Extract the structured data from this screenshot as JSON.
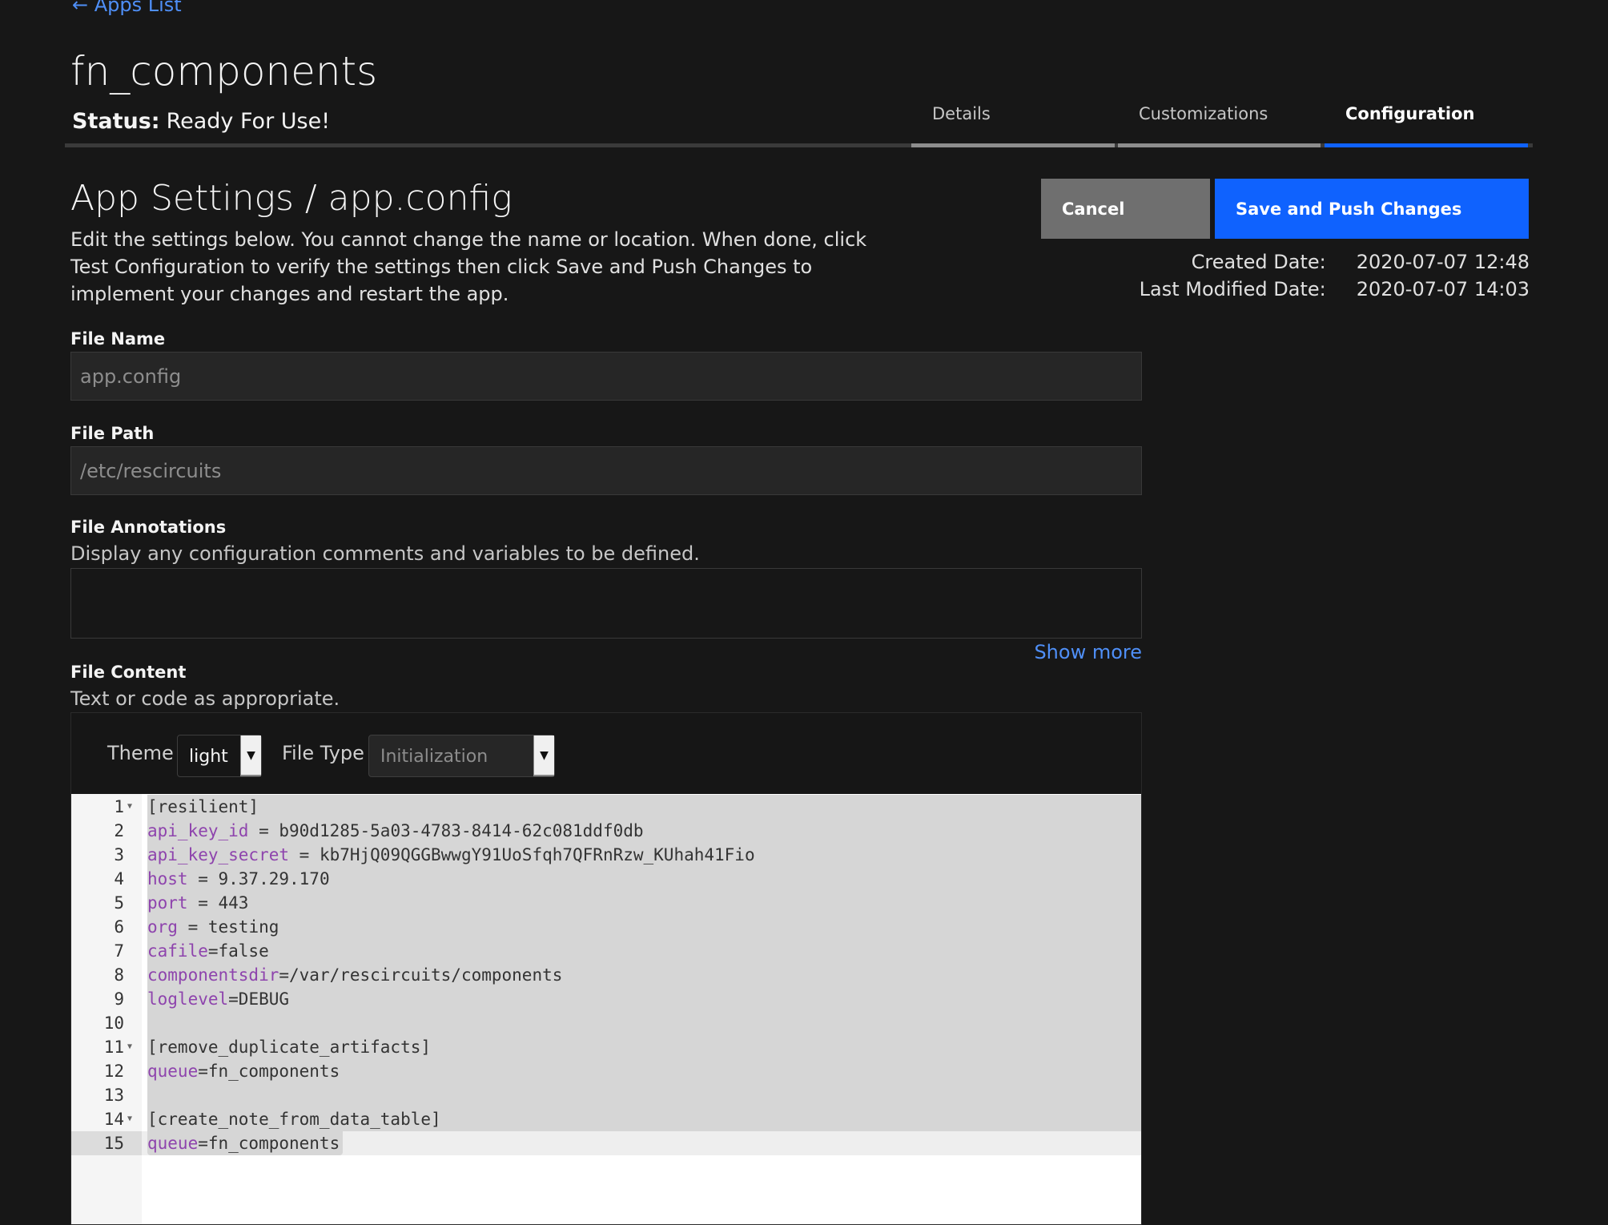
{
  "nav": {
    "back_label": "← Apps List"
  },
  "app": {
    "title": "fn_components",
    "status_label": "Status:",
    "status_value": "Ready For Use!"
  },
  "tabs": [
    {
      "label": "Details"
    },
    {
      "label": "Customizations"
    },
    {
      "label": "Configuration",
      "active": true
    }
  ],
  "settings": {
    "heading": "App Settings / app.config",
    "description": "Edit the settings below. You cannot change the name or location. When done, click Test Configuration to verify the settings then click Save and Push Changes to implement your changes and restart the app.",
    "cancel_label": "Cancel",
    "save_label": "Save and Push Changes",
    "created_label": "Created Date:",
    "created_value": "2020-07-07 12:48",
    "modified_label": "Last Modified Date:",
    "modified_value": "2020-07-07 14:03"
  },
  "form": {
    "file_name_label": "File Name",
    "file_name_value": "app.config",
    "file_path_label": "File Path",
    "file_path_value": "/etc/rescircuits",
    "annotations_label": "File Annotations",
    "annotations_desc": "Display any configuration comments and variables to be defined.",
    "show_more": "Show more",
    "content_label": "File Content",
    "content_desc": "Text or code as appropriate."
  },
  "editor": {
    "theme_label": "Theme",
    "theme_value": "light",
    "filetype_label": "File Type",
    "filetype_value": "Initialization",
    "lines": [
      {
        "n": "1",
        "fold": true,
        "key": "",
        "rest": "[resilient]"
      },
      {
        "n": "2",
        "key": "api_key_id",
        "rest": " = b90d1285-5a03-4783-8414-62c081ddf0db"
      },
      {
        "n": "3",
        "key": "api_key_secret",
        "rest": " = kb7HjQ09QGGBwwgY91UoSfqh7QFRnRzw_KUhah41Fio"
      },
      {
        "n": "4",
        "key": "host",
        "rest": " = 9.37.29.170"
      },
      {
        "n": "5",
        "key": "port",
        "rest": " = 443"
      },
      {
        "n": "6",
        "key": "org",
        "rest": " = testing"
      },
      {
        "n": "7",
        "key": "cafile",
        "rest": "=false"
      },
      {
        "n": "8",
        "key": "componentsdir",
        "rest": "=/var/rescircuits/components"
      },
      {
        "n": "9",
        "key": "loglevel",
        "rest": "=DEBUG"
      },
      {
        "n": "10",
        "key": "",
        "rest": ""
      },
      {
        "n": "11",
        "fold": true,
        "key": "",
        "rest": "[remove_duplicate_artifacts]"
      },
      {
        "n": "12",
        "key": "queue",
        "rest": "=fn_components"
      },
      {
        "n": "13",
        "key": "",
        "rest": ""
      },
      {
        "n": "14",
        "fold": true,
        "key": "",
        "rest": "[create_note_from_data_table]"
      },
      {
        "n": "15",
        "key": "queue",
        "rest": "=fn_components",
        "active": true
      }
    ]
  }
}
